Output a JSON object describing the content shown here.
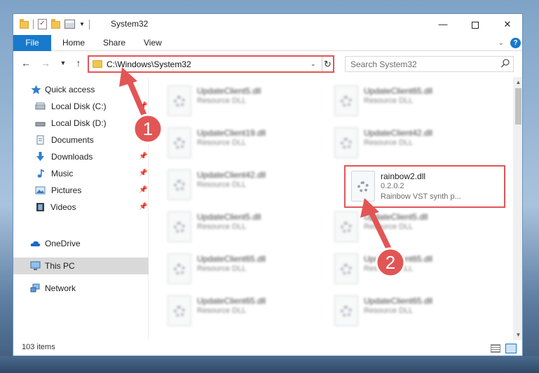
{
  "window": {
    "title": "System32",
    "ribbon_tabs": [
      "File",
      "Home",
      "Share",
      "View"
    ],
    "help": "?"
  },
  "address": {
    "path": "C:\\Windows\\System32",
    "search_placeholder": "Search System32"
  },
  "sidebar": {
    "items": [
      {
        "label": "Quick access",
        "icon": "star-icon",
        "pinned": false
      },
      {
        "label": "Local Disk (C:)",
        "icon": "drive-icon",
        "pinned": true
      },
      {
        "label": "Local Disk (D:)",
        "icon": "drive-icon",
        "pinned": true
      },
      {
        "label": "Documents",
        "icon": "documents-icon",
        "pinned": true
      },
      {
        "label": "Downloads",
        "icon": "download-arrow-icon",
        "pinned": true
      },
      {
        "label": "Music",
        "icon": "music-note-icon",
        "pinned": true
      },
      {
        "label": "Pictures",
        "icon": "pictures-icon",
        "pinned": true
      },
      {
        "label": "Videos",
        "icon": "film-icon",
        "pinned": true
      },
      {
        "label": "OneDrive",
        "icon": "cloud-icon",
        "pinned": false
      },
      {
        "label": "This PC",
        "icon": "monitor-icon",
        "pinned": false,
        "selected": true
      },
      {
        "label": "Network",
        "icon": "network-icon",
        "pinned": false
      }
    ]
  },
  "files": [
    {
      "name": "UpdateClient5.dll",
      "type": "Resource DLL"
    },
    {
      "name": "UpdateClient65.dll",
      "type": "Resource DLL"
    },
    {
      "name": "UpdateClient19.dll",
      "type": "Resource DLL"
    },
    {
      "name": "UpdateClient42.dll",
      "type": "Resource DLL"
    },
    {
      "name": "UpdateClient42.dll",
      "type": "Resource DLL"
    },
    {
      "name": "rainbow2.dll",
      "version": "0.2.0.2",
      "description": "Rainbow VST synth p...",
      "highlighted": true
    },
    {
      "name": "UpdateClient5.dll",
      "type": "Resource DLL"
    },
    {
      "name": "UpdateClient5.dll",
      "type": "Resource DLL"
    },
    {
      "name": "UpdateClient65.dll",
      "type": "Resource DLL"
    },
    {
      "name": "UpdateClient65.dll",
      "type": "Resource DLL"
    },
    {
      "name": "UpdateClient65.dll",
      "type": "Resource DLL"
    },
    {
      "name": "UpdateClient65.dll",
      "type": "Resource DLL"
    }
  ],
  "status": {
    "item_count": "103 items"
  },
  "annotations": [
    {
      "number": "1",
      "color": "#e25555"
    },
    {
      "number": "2",
      "color": "#e25555"
    }
  ]
}
